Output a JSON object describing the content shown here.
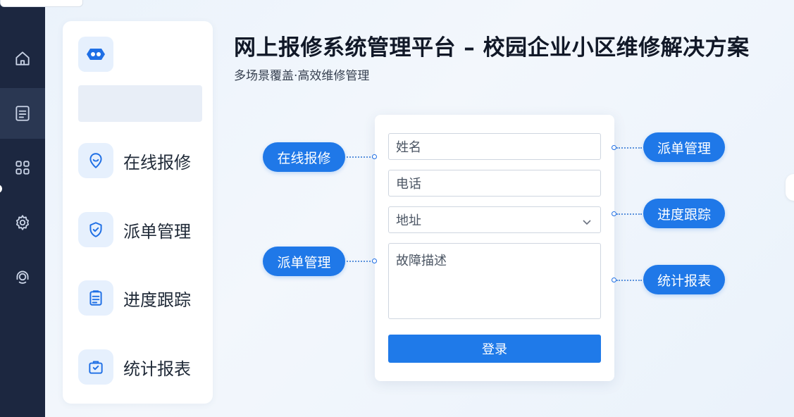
{
  "header": {
    "title": "网上报修系统管理平台 – 校园企业小区维修解决方案",
    "subtitle": "多场景覆盖·高效维修管理"
  },
  "rail": {
    "items": [
      {
        "icon": "home-icon"
      },
      {
        "icon": "document-icon",
        "active": true
      },
      {
        "icon": "grid-icon"
      },
      {
        "icon": "gear-icon"
      },
      {
        "icon": "support-icon"
      }
    ]
  },
  "sidebar": {
    "logo_icon": "robot-icon",
    "items": [
      {
        "label": "在线报修",
        "icon": "location-pin-icon"
      },
      {
        "label": "派单管理",
        "icon": "shield-check-icon"
      },
      {
        "label": "进度跟踪",
        "icon": "clipboard-icon"
      },
      {
        "label": "统计报表",
        "icon": "briefcase-check-icon"
      }
    ]
  },
  "form": {
    "name_placeholder": "姓名",
    "phone_placeholder": "电话",
    "address_placeholder": "地址",
    "description_placeholder": "故障描述",
    "submit_label": "登录"
  },
  "callouts": {
    "left": [
      "在线报修",
      "派单管理"
    ],
    "right": [
      "派单管理",
      "进度跟踪",
      "统计报表"
    ]
  },
  "colors": {
    "accent": "#1f78e8",
    "rail": "#1c2740",
    "background": "#eaf2fb"
  }
}
